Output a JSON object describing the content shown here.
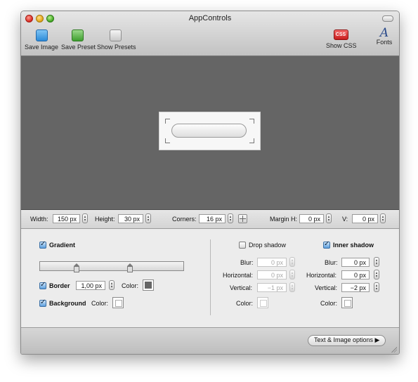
{
  "window": {
    "title": "AppControls"
  },
  "toolbar": {
    "save_image": {
      "label": "Save Image",
      "icon": "blue-square-icon"
    },
    "save_preset": {
      "label": "Save Preset",
      "icon": "green-square-icon"
    },
    "show_presets": {
      "label": "Show Presets",
      "icon": "gray-square-icon"
    },
    "show_css": {
      "label": "Show CSS",
      "icon_text": "CSS"
    },
    "fonts": {
      "label": "Fonts",
      "icon_text": "A"
    }
  },
  "dimensions": {
    "width_label": "Width:",
    "width_value": "150 px",
    "height_label": "Height:",
    "height_value": "30 px",
    "corners_label": "Corners:",
    "corners_value": "16 px",
    "margin_h_label": "Margin H:",
    "margin_h_value": "0 px",
    "v_label": "V:",
    "v_value": "0 px"
  },
  "gradient": {
    "label": "Gradient",
    "checked": true
  },
  "border": {
    "label": "Border",
    "checked": true,
    "value": "1,00 px",
    "color_label": "Color:",
    "color": "#666666"
  },
  "background": {
    "label": "Background",
    "checked": true,
    "color_label": "Color:"
  },
  "drop_shadow": {
    "label": "Drop shadow",
    "checked": false,
    "blur_label": "Blur:",
    "blur_value": "0 px",
    "horizontal_label": "Horizontal:",
    "horizontal_value": "0 px",
    "vertical_label": "Vertical:",
    "vertical_value": "−1 px",
    "color_label": "Color:"
  },
  "inner_shadow": {
    "label": "Inner shadow",
    "checked": true,
    "blur_label": "Blur:",
    "blur_value": "0 px",
    "horizontal_label": "Horizontal:",
    "horizontal_value": "0 px",
    "vertical_label": "Vertical:",
    "vertical_value": "−2 px",
    "color_label": "Color:"
  },
  "footer": {
    "options_label": "Text & Image options ▶"
  }
}
